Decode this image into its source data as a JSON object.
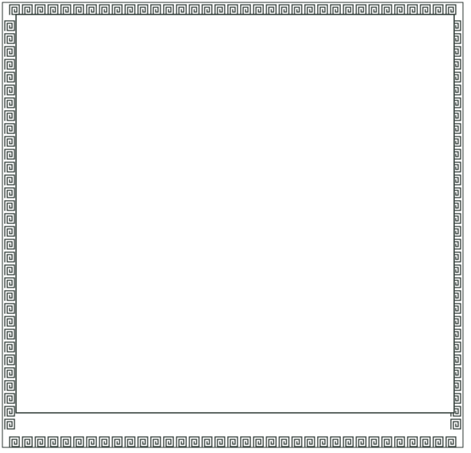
{
  "frame": {
    "style": "greek-key-meander-border",
    "stroke_color": "#2f3a36",
    "background_color": "#ffffff",
    "inner_panel_color": "#ffffff"
  }
}
